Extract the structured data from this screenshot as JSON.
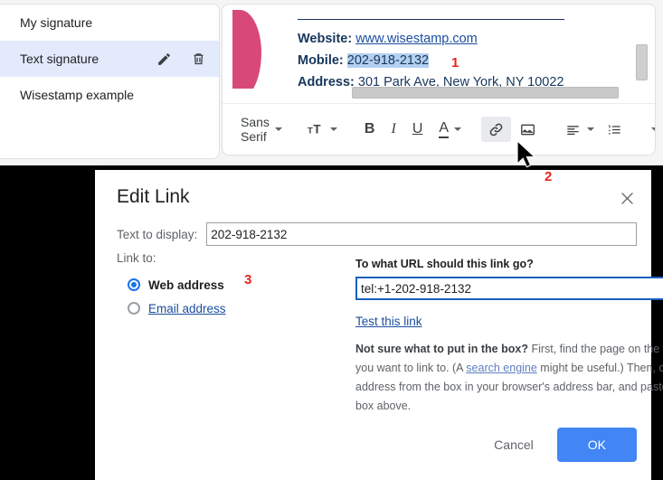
{
  "signature_list": {
    "items": [
      {
        "label": "My signature",
        "selected": false
      },
      {
        "label": "Text signature",
        "selected": true
      },
      {
        "label": "Wisestamp example",
        "selected": false
      }
    ],
    "edit_icon": "pencil-icon",
    "delete_icon": "trash-icon"
  },
  "preview": {
    "lines": [
      {
        "label": "Website:",
        "value": "www.wisestamp.com",
        "is_link": true
      },
      {
        "label": "Mobile:",
        "value": "202-918-2132",
        "is_link": false,
        "selected": true
      },
      {
        "label": "Address:",
        "value": "301 Park Ave, New York, NY 10022",
        "is_link": false
      }
    ],
    "accent_color": "#d8497a",
    "text_color": "#17365c",
    "link_color": "#1a4d9e",
    "selection_color": "#b4d0f0"
  },
  "toolbar": {
    "font_name": "Sans Serif",
    "items": [
      {
        "name": "font-family",
        "glyph": "Sans Serif"
      },
      {
        "name": "font-size",
        "glyph": "ᴛT"
      },
      {
        "name": "bold",
        "glyph": "B"
      },
      {
        "name": "italic",
        "glyph": "I"
      },
      {
        "name": "underline",
        "glyph": "U"
      },
      {
        "name": "text-color",
        "glyph": "A"
      },
      {
        "name": "insert-link",
        "glyph": "link"
      },
      {
        "name": "insert-image",
        "glyph": "image"
      },
      {
        "name": "align",
        "glyph": "align"
      },
      {
        "name": "numbered-list",
        "glyph": "list"
      },
      {
        "name": "more-options",
        "glyph": "caret"
      }
    ]
  },
  "dialog": {
    "title": "Edit Link",
    "close_label": "✕",
    "text_to_display": {
      "label": "Text to display:",
      "value": "202-918-2132"
    },
    "link_to": {
      "label": "Link to:",
      "options": [
        {
          "label": "Web address",
          "selected": true
        },
        {
          "label": "Email address",
          "selected": false
        }
      ]
    },
    "url": {
      "question": "To what URL should this link go?",
      "value": "tel:+1-202-918-2132",
      "test_link_label": "Test this link"
    },
    "help": {
      "lead": "Not sure what to put in the box?",
      "part1": " First, find the page on the web that you want to link to. (A ",
      "link": "search engine",
      "part2": " might be useful.) Then, copy the web address from the box in your browser's address bar, and paste it into the box above."
    },
    "buttons": {
      "cancel": "Cancel",
      "ok": "OK",
      "ok_color": "#4285f4"
    }
  },
  "annotations": {
    "marker_1": "1",
    "marker_2": "2",
    "marker_3": "3",
    "color": "#e8251b"
  }
}
